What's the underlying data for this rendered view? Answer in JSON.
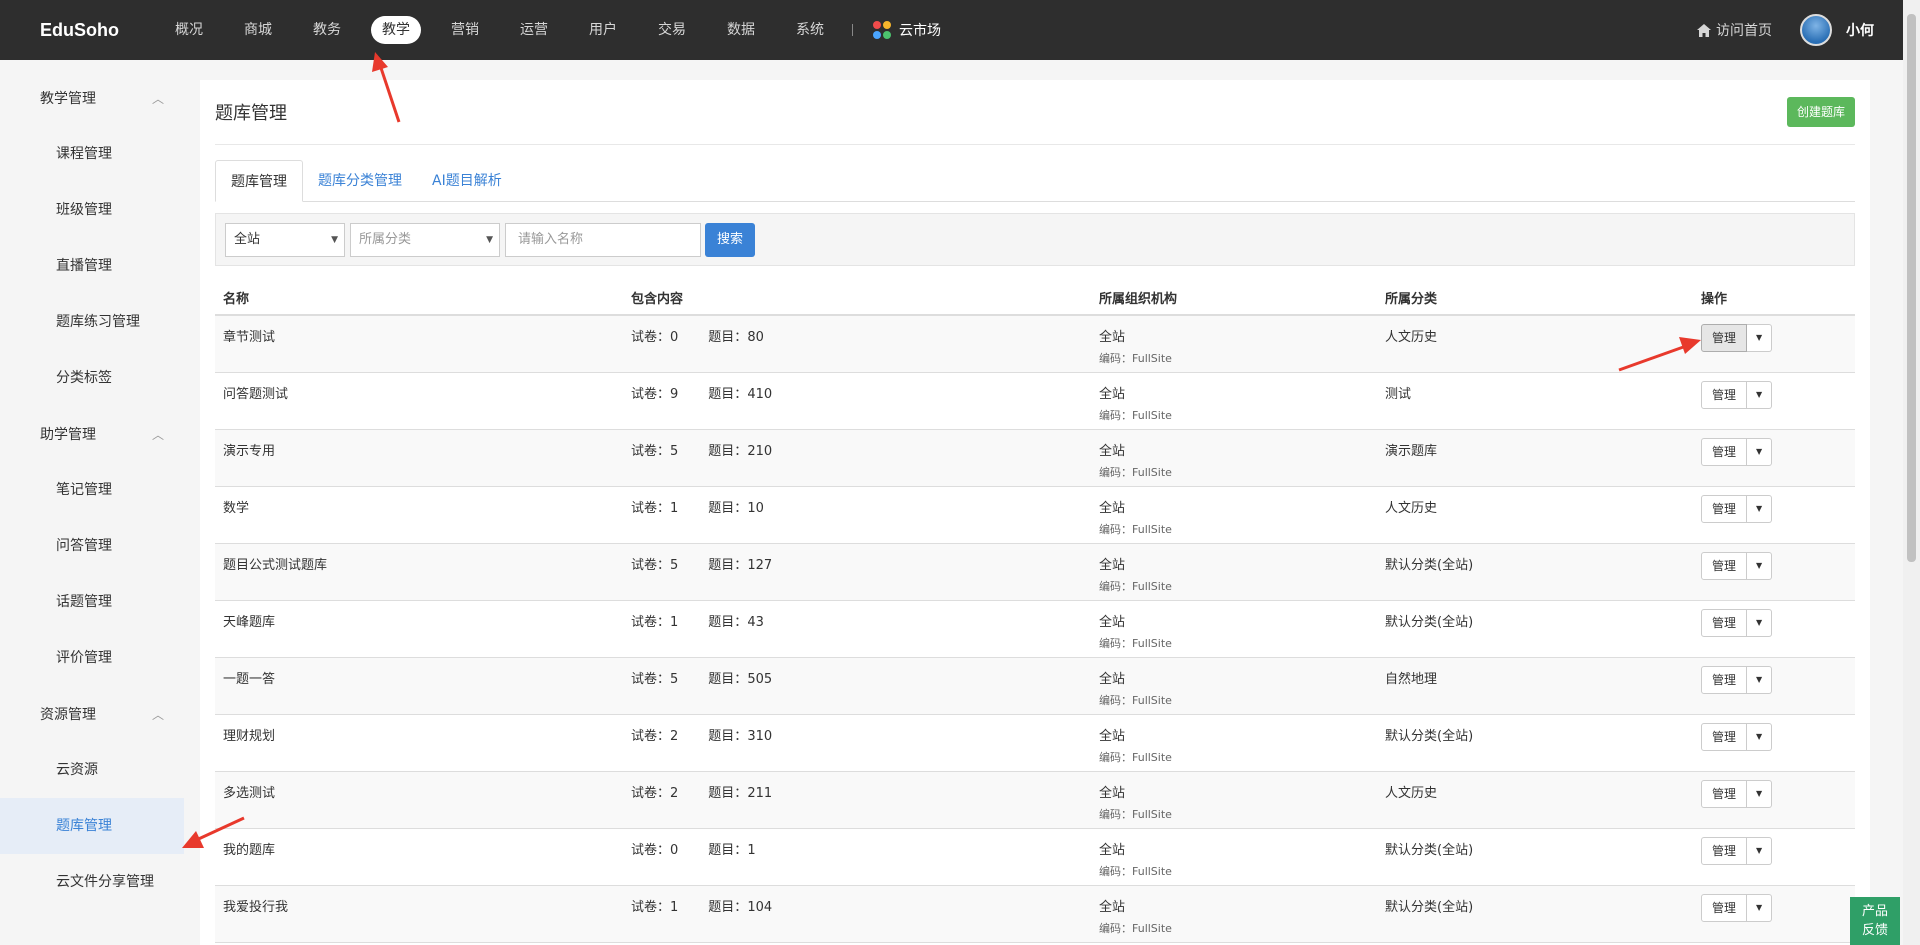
{
  "brand": "EduSoho",
  "nav": [
    "概况",
    "商城",
    "教务",
    "教学",
    "营销",
    "运营",
    "用户",
    "交易",
    "数据",
    "系统"
  ],
  "nav_active": "教学",
  "cloud_market": "云市场",
  "visit_home": "访问首页",
  "username": "小何",
  "sidebar": {
    "groups": [
      {
        "label": "教学管理",
        "items": [
          "课程管理",
          "班级管理",
          "直播管理",
          "题库练习管理",
          "分类标签"
        ]
      },
      {
        "label": "助学管理",
        "items": [
          "笔记管理",
          "问答管理",
          "话题管理",
          "评价管理"
        ]
      },
      {
        "label": "资源管理",
        "items": [
          "云资源",
          "题库管理",
          "云文件分享管理"
        ]
      }
    ],
    "active_item": "题库管理"
  },
  "page": {
    "title": "题库管理",
    "create_button": "创建题库",
    "tabs": [
      "题库管理",
      "题库分类管理",
      "AI题目解析"
    ],
    "active_tab": "题库管理"
  },
  "filter": {
    "org_select": "全站",
    "category_select": "所属分类",
    "name_placeholder": "请输入名称",
    "search_button": "搜索"
  },
  "table": {
    "headers": [
      "名称",
      "包含内容",
      "所属组织机构",
      "所属分类",
      "操作"
    ],
    "labels": {
      "papers": "试卷：",
      "questions": "题目：",
      "code": "编码：",
      "manage": "管理"
    },
    "rows": [
      {
        "name": "章节测试",
        "papers": "0",
        "questions": "80",
        "org": "全站",
        "code": "FullSite",
        "category": "人文历史"
      },
      {
        "name": "问答题测试",
        "papers": "9",
        "questions": "410",
        "org": "全站",
        "code": "FullSite",
        "category": "测试"
      },
      {
        "name": "演示专用",
        "papers": "5",
        "questions": "210",
        "org": "全站",
        "code": "FullSite",
        "category": "演示题库"
      },
      {
        "name": "数学",
        "papers": "1",
        "questions": "10",
        "org": "全站",
        "code": "FullSite",
        "category": "人文历史"
      },
      {
        "name": "题目公式测试题库",
        "papers": "5",
        "questions": "127",
        "org": "全站",
        "code": "FullSite",
        "category": "默认分类(全站)"
      },
      {
        "name": "天峰题库",
        "papers": "1",
        "questions": "43",
        "org": "全站",
        "code": "FullSite",
        "category": "默认分类(全站)"
      },
      {
        "name": "一题一答",
        "papers": "5",
        "questions": "505",
        "org": "全站",
        "code": "FullSite",
        "category": "自然地理"
      },
      {
        "name": "理财规划",
        "papers": "2",
        "questions": "310",
        "org": "全站",
        "code": "FullSite",
        "category": "默认分类(全站)"
      },
      {
        "name": "多选测试",
        "papers": "2",
        "questions": "211",
        "org": "全站",
        "code": "FullSite",
        "category": "人文历史"
      },
      {
        "name": "我的题库",
        "papers": "0",
        "questions": "1",
        "org": "全站",
        "code": "FullSite",
        "category": "默认分类(全站)"
      },
      {
        "name": "我爱投行我",
        "papers": "1",
        "questions": "104",
        "org": "全站",
        "code": "FullSite",
        "category": "默认分类(全站)"
      }
    ]
  },
  "feedback": [
    "产品",
    "反馈"
  ],
  "colors": {
    "topbar": "#2e2e2e",
    "accent": "#3a82d6",
    "create": "#5cb85c",
    "feedback": "#2f9f67",
    "annotation_arrow": "#e8392c"
  }
}
